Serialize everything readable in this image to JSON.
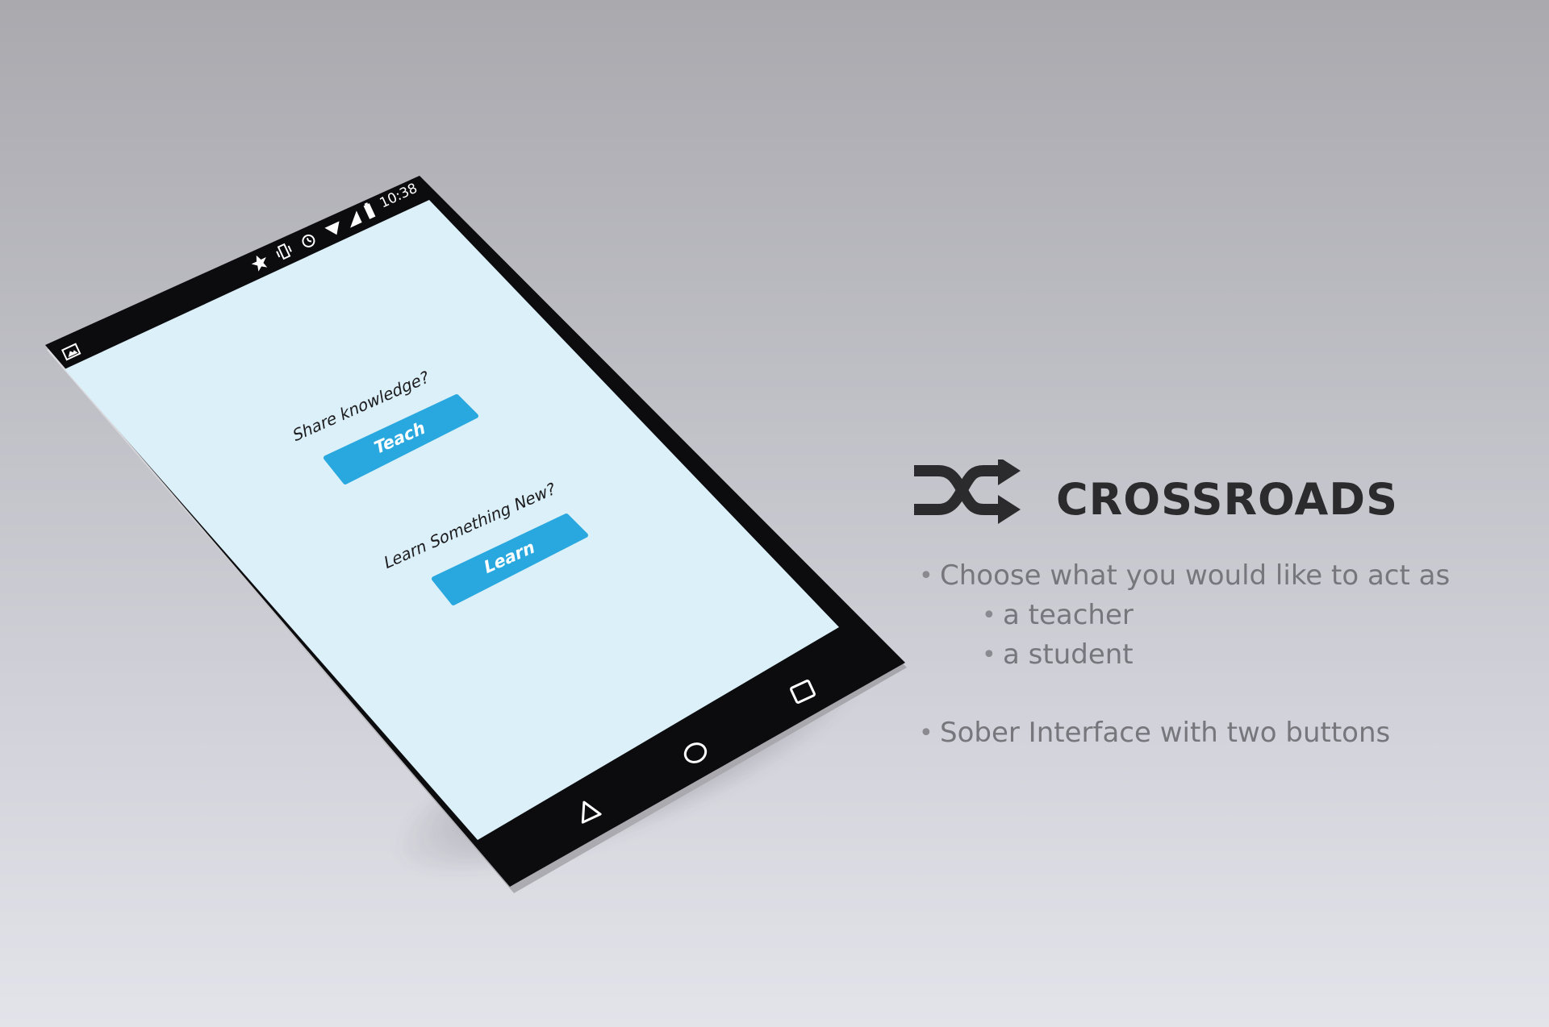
{
  "app": {
    "name": "CROSSROADS",
    "logo_icon": "shuffle-icon"
  },
  "phone": {
    "status_bar": {
      "time": "10:38",
      "icons": [
        "image-icon",
        "star-icon",
        "vibrate-icon",
        "alarm-icon",
        "wifi-icon",
        "signal-icon",
        "battery-icon"
      ]
    },
    "screen": {
      "background": "#dcf0f9",
      "teach_prompt": "Share knowledge?",
      "teach_button": "Teach",
      "learn_prompt": "Learn Something New?",
      "learn_button": "Learn",
      "button_color": "#29a8e0"
    },
    "nav_bar": {
      "icons": [
        "back-icon",
        "home-icon",
        "recents-icon"
      ]
    }
  },
  "features": {
    "intro": "Choose what you would like to act as",
    "options": [
      "a teacher",
      "a student"
    ],
    "note": "Sober Interface with two buttons"
  },
  "colors": {
    "title": "#2b2b2e",
    "body_text": "#76767c",
    "device_frame": "#0c0c0e"
  }
}
